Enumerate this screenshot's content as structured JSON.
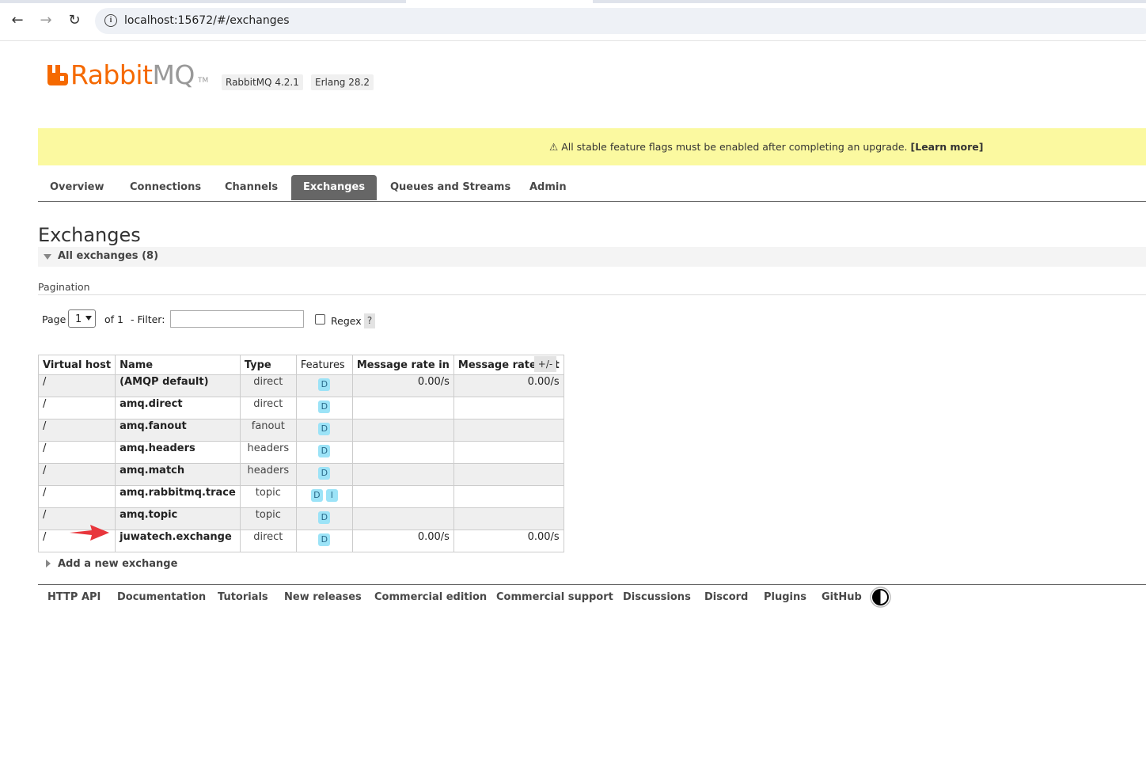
{
  "browser": {
    "url": "localhost:15672/#/exchanges"
  },
  "header": {
    "logo_text_a": "Rabbit",
    "logo_text_b": "MQ",
    "logo_tm": "TM",
    "version": "RabbitMQ 4.2.1",
    "erlang": "Erlang 28.2"
  },
  "banner": {
    "icon": "⚠",
    "text": "All stable feature flags must be enabled after completing an upgrade.",
    "link": "[Learn more]"
  },
  "tabs": [
    {
      "label": "Overview",
      "active": false
    },
    {
      "label": "Connections",
      "active": false
    },
    {
      "label": "Channels",
      "active": false
    },
    {
      "label": "Exchanges",
      "active": true
    },
    {
      "label": "Queues and Streams",
      "active": false
    },
    {
      "label": "Admin",
      "active": false
    }
  ],
  "page": {
    "title": "Exchanges",
    "section_title": "All exchanges (8)"
  },
  "pagination": {
    "heading": "Pagination",
    "page_label": "Page",
    "page_value": "1",
    "of_label": "of 1",
    "filter_label": "- Filter:",
    "filter_value": "",
    "regex_label": "Regex",
    "help_label": "?"
  },
  "table": {
    "columns": [
      "Virtual host",
      "Name",
      "Type",
      "Features",
      "Message rate in",
      "Message rate out"
    ],
    "toggle_label": "+/-",
    "rows": [
      {
        "vhost": "/",
        "name": "(AMQP default)",
        "type": "direct",
        "features": [
          "D"
        ],
        "rate_in": "0.00/s",
        "rate_out": "0.00/s"
      },
      {
        "vhost": "/",
        "name": "amq.direct",
        "type": "direct",
        "features": [
          "D"
        ],
        "rate_in": "",
        "rate_out": ""
      },
      {
        "vhost": "/",
        "name": "amq.fanout",
        "type": "fanout",
        "features": [
          "D"
        ],
        "rate_in": "",
        "rate_out": ""
      },
      {
        "vhost": "/",
        "name": "amq.headers",
        "type": "headers",
        "features": [
          "D"
        ],
        "rate_in": "",
        "rate_out": ""
      },
      {
        "vhost": "/",
        "name": "amq.match",
        "type": "headers",
        "features": [
          "D"
        ],
        "rate_in": "",
        "rate_out": ""
      },
      {
        "vhost": "/",
        "name": "amq.rabbitmq.trace",
        "type": "topic",
        "features": [
          "D",
          "I"
        ],
        "rate_in": "",
        "rate_out": ""
      },
      {
        "vhost": "/",
        "name": "amq.topic",
        "type": "topic",
        "features": [
          "D"
        ],
        "rate_in": "",
        "rate_out": ""
      },
      {
        "vhost": "/",
        "name": "juwatech.exchange",
        "type": "direct",
        "features": [
          "D"
        ],
        "rate_in": "0.00/s",
        "rate_out": "0.00/s"
      }
    ]
  },
  "add_exchange": {
    "label": "Add a new exchange"
  },
  "footer": {
    "links": [
      "HTTP API",
      "Documentation",
      "Tutorials",
      "New releases",
      "Commercial edition",
      "Commercial support",
      "Discussions",
      "Discord",
      "Plugins",
      "GitHub"
    ]
  },
  "colors": {
    "brand": "#f56900",
    "banner": "#fbf9a0",
    "active_tab": "#666666",
    "badge": "#9ce3f7",
    "annotation_arrow": "#e8363c"
  },
  "icons": {
    "back": "arrow-left-icon",
    "forward": "arrow-right-icon",
    "reload": "reload-icon",
    "site_info": "info-icon",
    "theme": "contrast-icon",
    "annotation": "red-arrow-icon"
  }
}
